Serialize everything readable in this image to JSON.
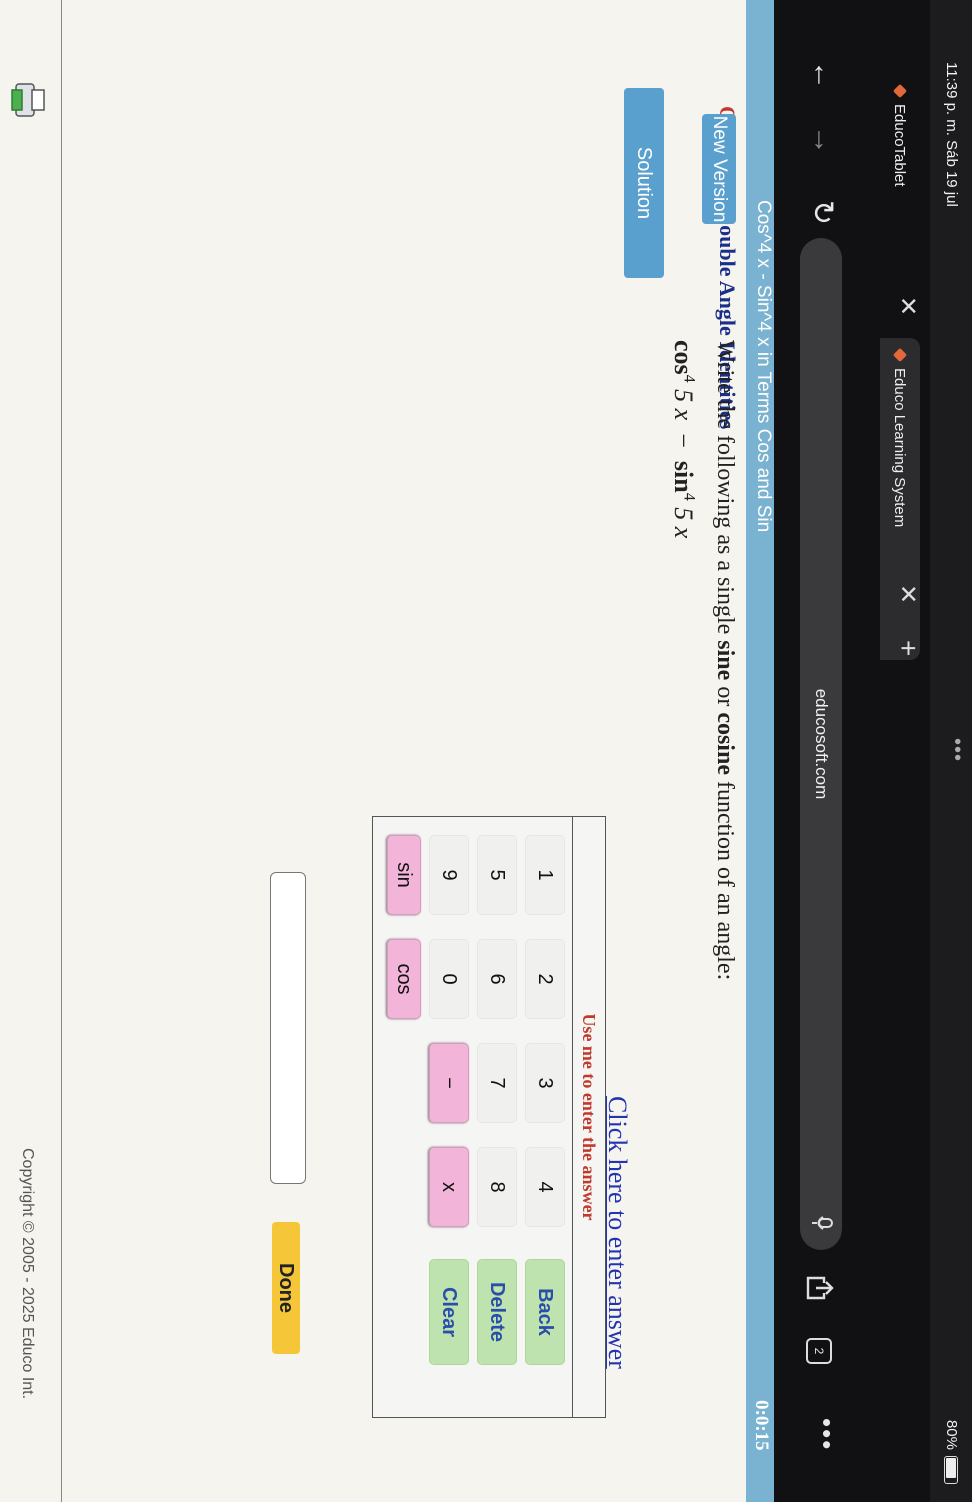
{
  "status": {
    "time": "11:39 p. m.  Sáb 19 jul",
    "dots": "•••",
    "battery": "80%"
  },
  "tabs": [
    {
      "title": "EducoTablet",
      "close": "✕"
    },
    {
      "title": "Educo Learning System",
      "close": "✕"
    }
  ],
  "new_tab": "+",
  "nav": {
    "url": "educosoft.com",
    "tab_count": "2",
    "more": "•••"
  },
  "header": {
    "title": "Cos^4 x - Sin^4 x in Terms Cos and Sin",
    "timer": "0:0:15"
  },
  "objective": {
    "label": "Objective:",
    "text": "Double Angle Identities"
  },
  "buttons": {
    "new_version": "New Version",
    "solution": "Solution",
    "done": "Done"
  },
  "question": {
    "prefix": "Write the following as a single ",
    "sine": "sine",
    "middle": " or ",
    "cosine": "cosine",
    "suffix": " function of an angle:"
  },
  "expression": {
    "cos": "cos",
    "cos_exp": "4",
    "cos_arg": "5 x",
    "minus": "−",
    "sin": "sin",
    "sin_exp": "4",
    "sin_arg": "5 x"
  },
  "enter_link": "Click here to enter answer",
  "keypad": {
    "title": "Use me to enter the answer",
    "rows": [
      [
        "1",
        "2",
        "3",
        "4",
        "Back"
      ],
      [
        "5",
        "6",
        "7",
        "8",
        "Delete"
      ],
      [
        "9",
        "0",
        "−",
        "x",
        "Clear"
      ],
      [
        "sin",
        "cos"
      ]
    ]
  },
  "footer": {
    "copyright": "Copyright © 2005 - 2025 Educo Int."
  }
}
